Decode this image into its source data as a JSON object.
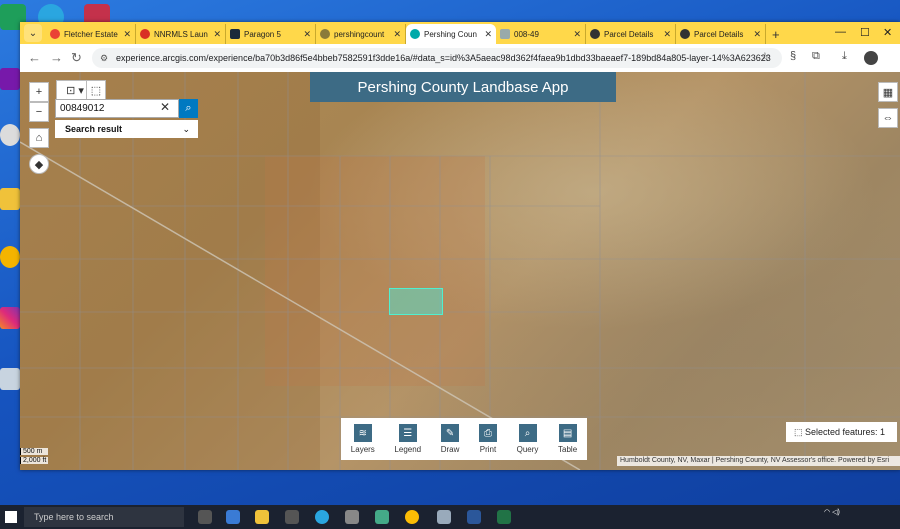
{
  "browser": {
    "tabs": [
      {
        "label": "Fletcher Estate",
        "color": "#ea4335"
      },
      {
        "label": "NNRMLS Laun",
        "color": "#d93025"
      },
      {
        "label": "Paragon 5",
        "color": "#1a2a3a"
      },
      {
        "label": "pershingcount",
        "color": "#8a7a3a"
      },
      {
        "label": "Pershing Coun",
        "color": "#0aa",
        "active": true
      },
      {
        "label": "008-49",
        "color": "#9aa"
      },
      {
        "label": "Parcel Details",
        "color": "#333"
      },
      {
        "label": "Parcel Details",
        "color": "#333"
      }
    ],
    "url": "experience.arcgis.com/experience/ba70b3d86f5e4bbeb7582591f3dde16a/#data_s=id%3A5aeac98d362f4faea9b1dbd33baeaef7-189bd84a805-layer-14%3A623623"
  },
  "app": {
    "title": "Pershing County Landbase App",
    "search_value": "00849012",
    "search_result_label": "Search result",
    "selected_features": "Selected features: 1",
    "attribution": "Humboldt County, NV, Maxar | Pershing County, NV Assessor's office.  Powered by Esri",
    "scale_m": "500 m",
    "scale_ft": "2,000 ft",
    "tools": [
      {
        "label": "Layers",
        "icon": "layers-icon"
      },
      {
        "label": "Legend",
        "icon": "legend-icon"
      },
      {
        "label": "Draw",
        "icon": "draw-icon"
      },
      {
        "label": "Print",
        "icon": "print-icon"
      },
      {
        "label": "Query",
        "icon": "query-icon"
      },
      {
        "label": "Table",
        "icon": "table-icon"
      }
    ]
  },
  "taskbar": {
    "search_placeholder": "Type here to search"
  }
}
